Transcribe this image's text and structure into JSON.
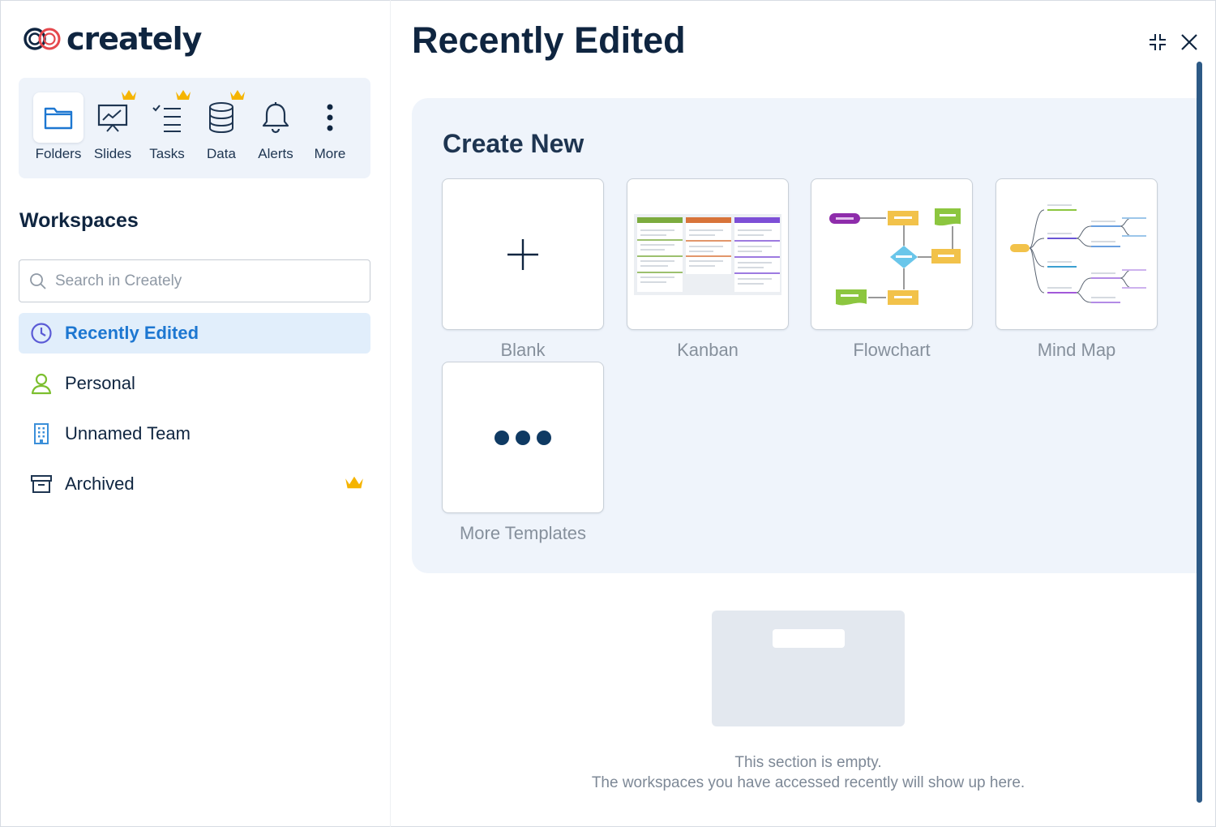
{
  "app": {
    "logo_text": "creately"
  },
  "toolbar": {
    "items": [
      {
        "label": "Folders",
        "icon": "folder-icon",
        "premium": false,
        "active": true
      },
      {
        "label": "Slides",
        "icon": "presentation-icon",
        "premium": true,
        "active": false
      },
      {
        "label": "Tasks",
        "icon": "checklist-icon",
        "premium": true,
        "active": false
      },
      {
        "label": "Data",
        "icon": "database-icon",
        "premium": true,
        "active": false
      },
      {
        "label": "Alerts",
        "icon": "bell-icon",
        "premium": false,
        "active": false
      },
      {
        "label": "More",
        "icon": "more-vertical-icon",
        "premium": false,
        "active": false
      }
    ]
  },
  "workspaces": {
    "title": "Workspaces",
    "search_placeholder": "Search in Creately",
    "items": [
      {
        "label": "Recently Edited",
        "icon": "clock-icon",
        "active": true,
        "premium": false
      },
      {
        "label": "Personal",
        "icon": "user-icon",
        "active": false,
        "premium": false
      },
      {
        "label": "Unnamed Team",
        "icon": "building-icon",
        "active": false,
        "premium": false
      },
      {
        "label": "Archived",
        "icon": "archive-icon",
        "active": false,
        "premium": true
      }
    ]
  },
  "main": {
    "title": "Recently Edited",
    "create_new": {
      "title": "Create New",
      "templates": [
        {
          "label": "Blank"
        },
        {
          "label": "Kanban"
        },
        {
          "label": "Flowchart"
        },
        {
          "label": "Mind Map"
        },
        {
          "label": "More Templates"
        }
      ]
    },
    "empty": {
      "line1": "This section is empty.",
      "line2": "The workspaces you have accessed recently will show up here."
    }
  },
  "colors": {
    "accent": "#1d77d1",
    "text_dark": "#0f2540",
    "crown": "#f5b400",
    "panel_bg": "#eff4fb"
  }
}
